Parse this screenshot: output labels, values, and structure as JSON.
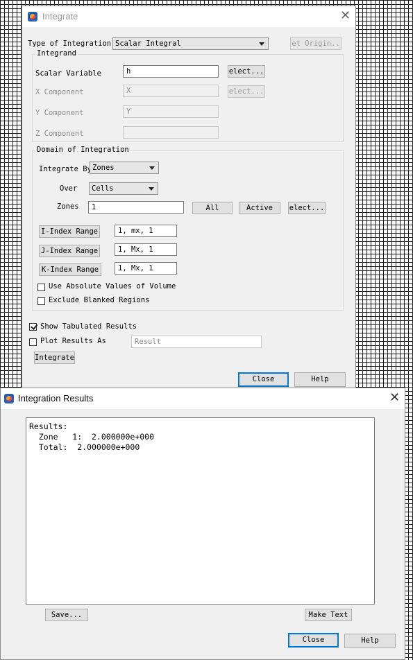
{
  "integrate_dialog": {
    "title": "Integrate",
    "type_label": "Type of Integration",
    "type_value": "Scalar Integral",
    "set_origin": "et Origin..",
    "integrand": {
      "title": "Integrand",
      "scalar_variable_label": "Scalar Variable",
      "scalar_variable_value": "h",
      "x_component_label": "X Component",
      "x_component_value": "X",
      "y_component_label": "Y Component",
      "y_component_value": "Y",
      "z_component_label": "Z Component",
      "z_component_value": "",
      "select_label": "elect..."
    },
    "domain": {
      "title": "Domain of Integration",
      "integrate_by_label": "Integrate By",
      "integrate_by_value": "Zones",
      "over_label": "Over",
      "over_value": "Cells",
      "zones_label": "Zones",
      "zones_value": "1",
      "all_label": "All",
      "active_label": "Active",
      "select_label": "elect...",
      "i_range_label": "I-Index Range",
      "i_range_value": "1, mx, 1",
      "j_range_label": "J-Index Range",
      "j_range_value": "1, Mx, 1",
      "k_range_label": "K-Index Range",
      "k_range_value": "1, Mx, 1",
      "absolute_label": "Use Absolute Values of Volume",
      "absolute_checked": false,
      "exclude_label": "Exclude Blanked Regions",
      "exclude_checked": false
    },
    "show_tabulated_label": "Show Tabulated Results",
    "show_tabulated_checked": true,
    "plot_results_label": "Plot Results As",
    "plot_results_checked": false,
    "plot_results_placeholder": "Result",
    "integrate_button": "Integrate",
    "close_button": "Close",
    "help_button": "Help"
  },
  "results_dialog": {
    "title": "Integration Results",
    "lines": [
      "Results:",
      "  Zone   1:  2.000000e+000",
      "  Total:  2.000000e+000"
    ],
    "save_button": "Save...",
    "make_text_button": "Make Text",
    "close_button": "Close",
    "help_button": "Help"
  }
}
